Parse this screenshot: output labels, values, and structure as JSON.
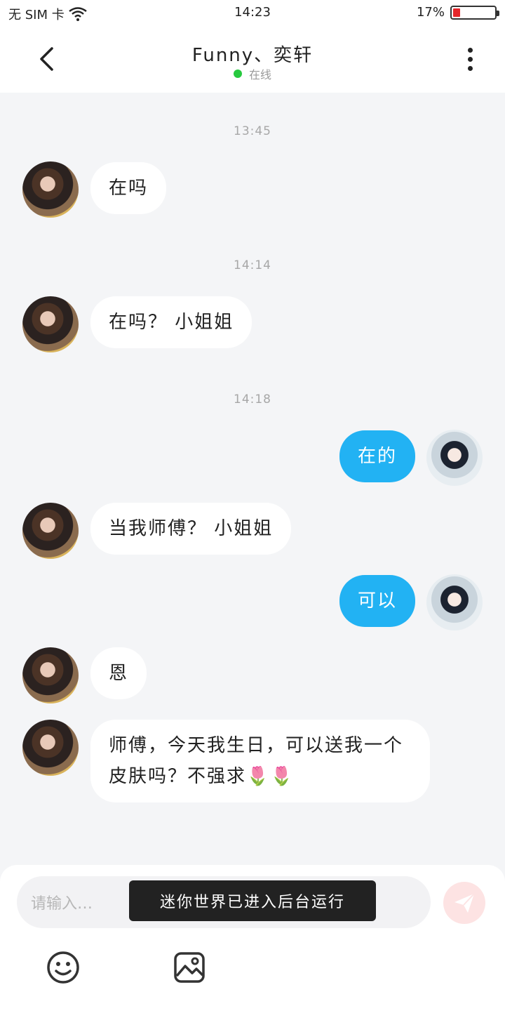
{
  "status_bar": {
    "carrier": "无 SIM 卡",
    "time": "14:23",
    "battery_text": "17%",
    "battery_level": 0.17
  },
  "header": {
    "title": "Funny、奕轩",
    "presence": "在线"
  },
  "messages": [
    {
      "type": "time",
      "text": "13:45"
    },
    {
      "type": "in",
      "text": "在吗"
    },
    {
      "type": "time",
      "text": "14:14"
    },
    {
      "type": "in",
      "text": "在吗？ 小姐姐"
    },
    {
      "type": "time",
      "text": "14:18"
    },
    {
      "type": "out",
      "text": "在的"
    },
    {
      "type": "in",
      "text": "当我师傅？ 小姐姐"
    },
    {
      "type": "out",
      "text": "可以"
    },
    {
      "type": "in",
      "text": "恩"
    },
    {
      "type": "in",
      "text": "师傅，今天我生日，可以送我一个皮肤吗？不强求🌷🌷"
    }
  ],
  "input": {
    "placeholder": "请输入…"
  },
  "toast": "迷你世界已进入后台运行",
  "colors": {
    "outgoing_bubble": "#22b2f3",
    "online_dot": "#27c93f",
    "send_button": "#fde3e3"
  }
}
